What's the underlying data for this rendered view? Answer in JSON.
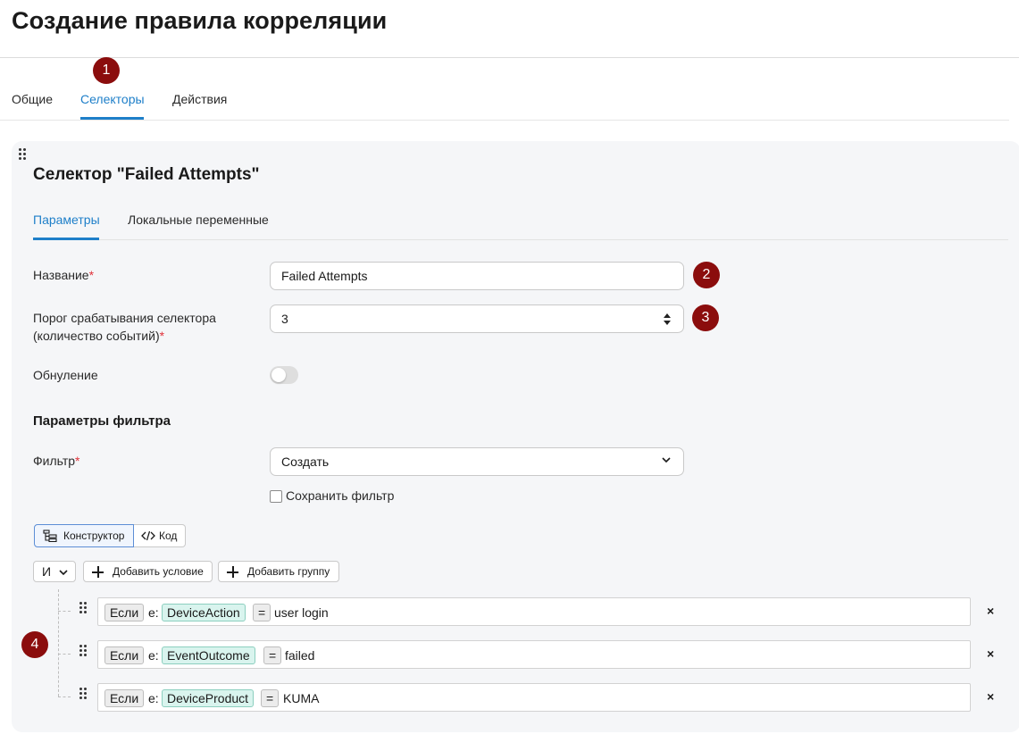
{
  "page": {
    "title": "Создание правила корреляции"
  },
  "main_tabs": [
    {
      "label": "Общие"
    },
    {
      "label": "Селекторы"
    },
    {
      "label": "Действия"
    }
  ],
  "markers": [
    "1",
    "2",
    "3",
    "4"
  ],
  "selector": {
    "title": "Селектор \"Failed Attempts\"",
    "tabs": [
      {
        "label": "Параметры"
      },
      {
        "label": "Локальные переменные"
      }
    ],
    "fields": {
      "name_label": "Название",
      "name_value": "Failed Attempts",
      "threshold_label_line1": "Порог срабатывания селектора",
      "threshold_label_line2": "(количество событий)",
      "threshold_value": "3",
      "reset_label": "Обнуление",
      "required_mark": "*"
    },
    "filter": {
      "section_title": "Параметры фильтра",
      "filter_label": "Фильтр",
      "filter_value": "Создать",
      "save_filter_label": "Сохранить фильтр",
      "mode_constructor": "Конструктор",
      "mode_code": "Код",
      "logic_operator": "И",
      "add_condition": "Добавить условие",
      "add_group": "Добавить группу",
      "conditions": [
        {
          "if": "Если",
          "prefix": "e:",
          "field": "DeviceAction",
          "op": "=",
          "value": "user login"
        },
        {
          "if": "Если",
          "prefix": "e:",
          "field": "EventOutcome",
          "op": "=",
          "value": "failed"
        },
        {
          "if": "Если",
          "prefix": "e:",
          "field": "DeviceProduct",
          "op": "=",
          "value": "KUMA"
        }
      ],
      "remove_symbol": "×"
    }
  },
  "colors": {
    "accent": "#1e7fc9",
    "marker": "#8b0d0d",
    "required": "#e0333b",
    "field_chip": "#d9f4ee"
  },
  "icons": [
    "drag-handle-icon",
    "spinner-icon",
    "chevron-down-icon",
    "constructor-icon",
    "code-icon",
    "plus-icon",
    "close-icon"
  ]
}
